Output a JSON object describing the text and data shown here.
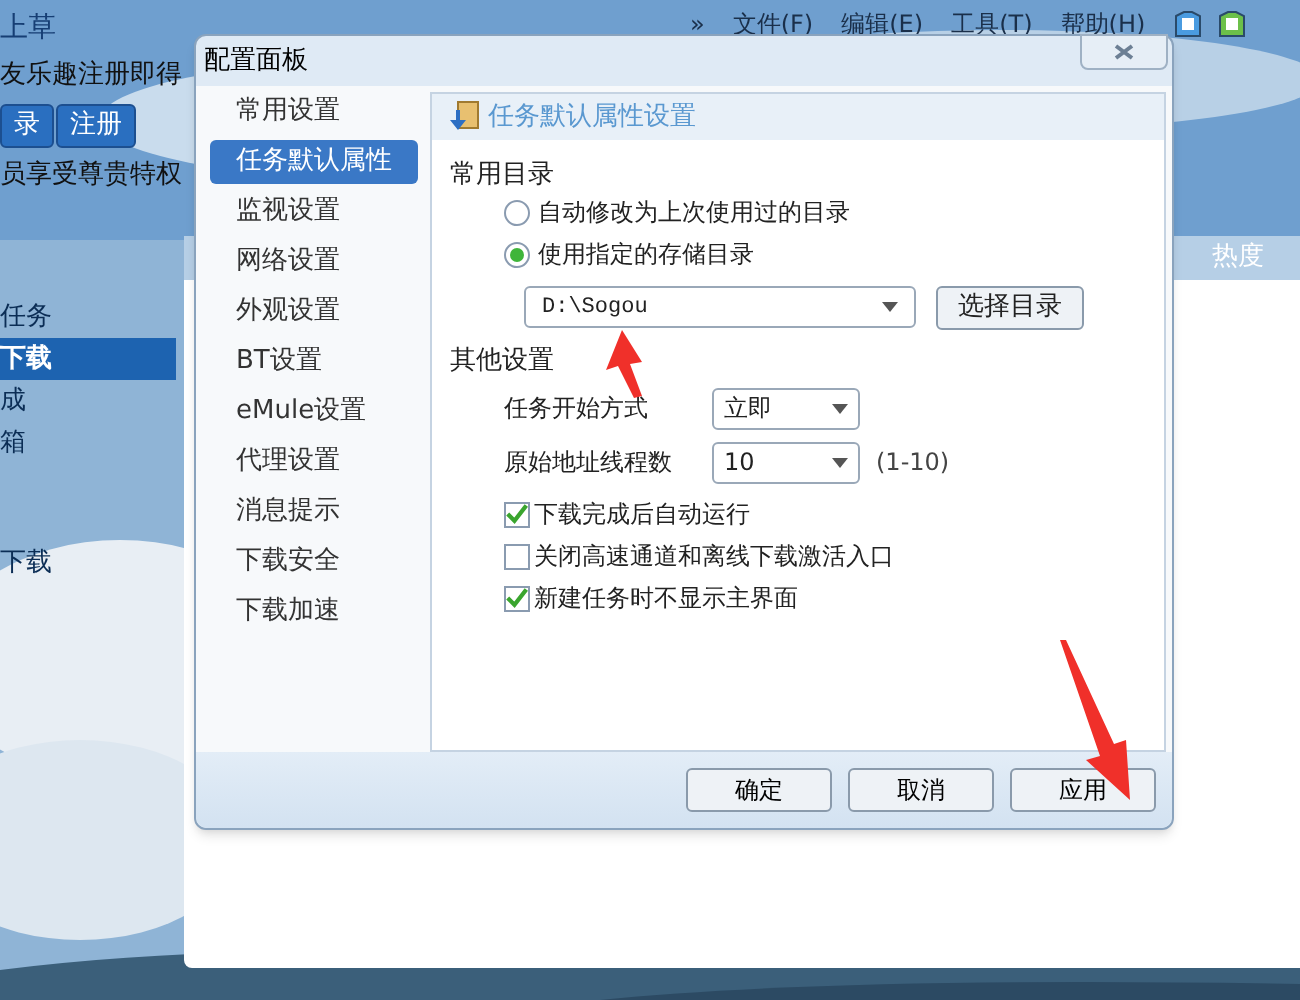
{
  "background_app": {
    "menu": [
      "»",
      "文件(F)",
      "编辑(E)",
      "工具(T)",
      "帮助(H)"
    ],
    "left_panel": {
      "title": "上草",
      "promo": "友乐趣注册即得",
      "buttons": [
        "录",
        "注册"
      ],
      "vip": "员享受尊贵特权",
      "nav": [
        {
          "label": "任务",
          "selected": false
        },
        {
          "label": "下载",
          "selected": true
        },
        {
          "label": "成",
          "selected": false
        },
        {
          "label": "箱",
          "selected": false
        }
      ],
      "nav_2": [
        {
          "label": "下载",
          "selected": false
        }
      ]
    },
    "table": {
      "columns": [
        "热度"
      ]
    }
  },
  "dialog": {
    "title": "配置面板",
    "categories": [
      {
        "label": "常用设置",
        "selected": false
      },
      {
        "label": "任务默认属性",
        "selected": true
      },
      {
        "label": "监视设置",
        "selected": false
      },
      {
        "label": "网络设置",
        "selected": false
      },
      {
        "label": "外观设置",
        "selected": false
      },
      {
        "label": "BT设置",
        "selected": false
      },
      {
        "label": "eMule设置",
        "selected": false
      },
      {
        "label": "代理设置",
        "selected": false
      },
      {
        "label": "消息提示",
        "selected": false
      },
      {
        "label": "下载安全",
        "selected": false
      },
      {
        "label": "下载加速",
        "selected": false
      }
    ],
    "panel_title": "任务默认属性设置",
    "directory": {
      "heading": "常用目录",
      "options": [
        {
          "label": "自动修改为上次使用过的目录",
          "selected": false
        },
        {
          "label": "使用指定的存储目录",
          "selected": true
        }
      ],
      "path": "D:\\Sogou",
      "browse_button": "选择目录"
    },
    "other": {
      "heading": "其他设置",
      "fields": [
        {
          "label": "任务开始方式",
          "value": "立即"
        },
        {
          "label": "原始地址线程数",
          "value": "10",
          "hint": "(1-10)"
        }
      ],
      "checkboxes": [
        {
          "label": "下载完成后自动运行",
          "checked": true
        },
        {
          "label": "关闭高速通道和离线下载激活入口",
          "checked": false
        },
        {
          "label": "新建任务时不显示主界面",
          "checked": true
        }
      ]
    },
    "buttons": [
      "确定",
      "取消",
      "应用"
    ]
  }
}
